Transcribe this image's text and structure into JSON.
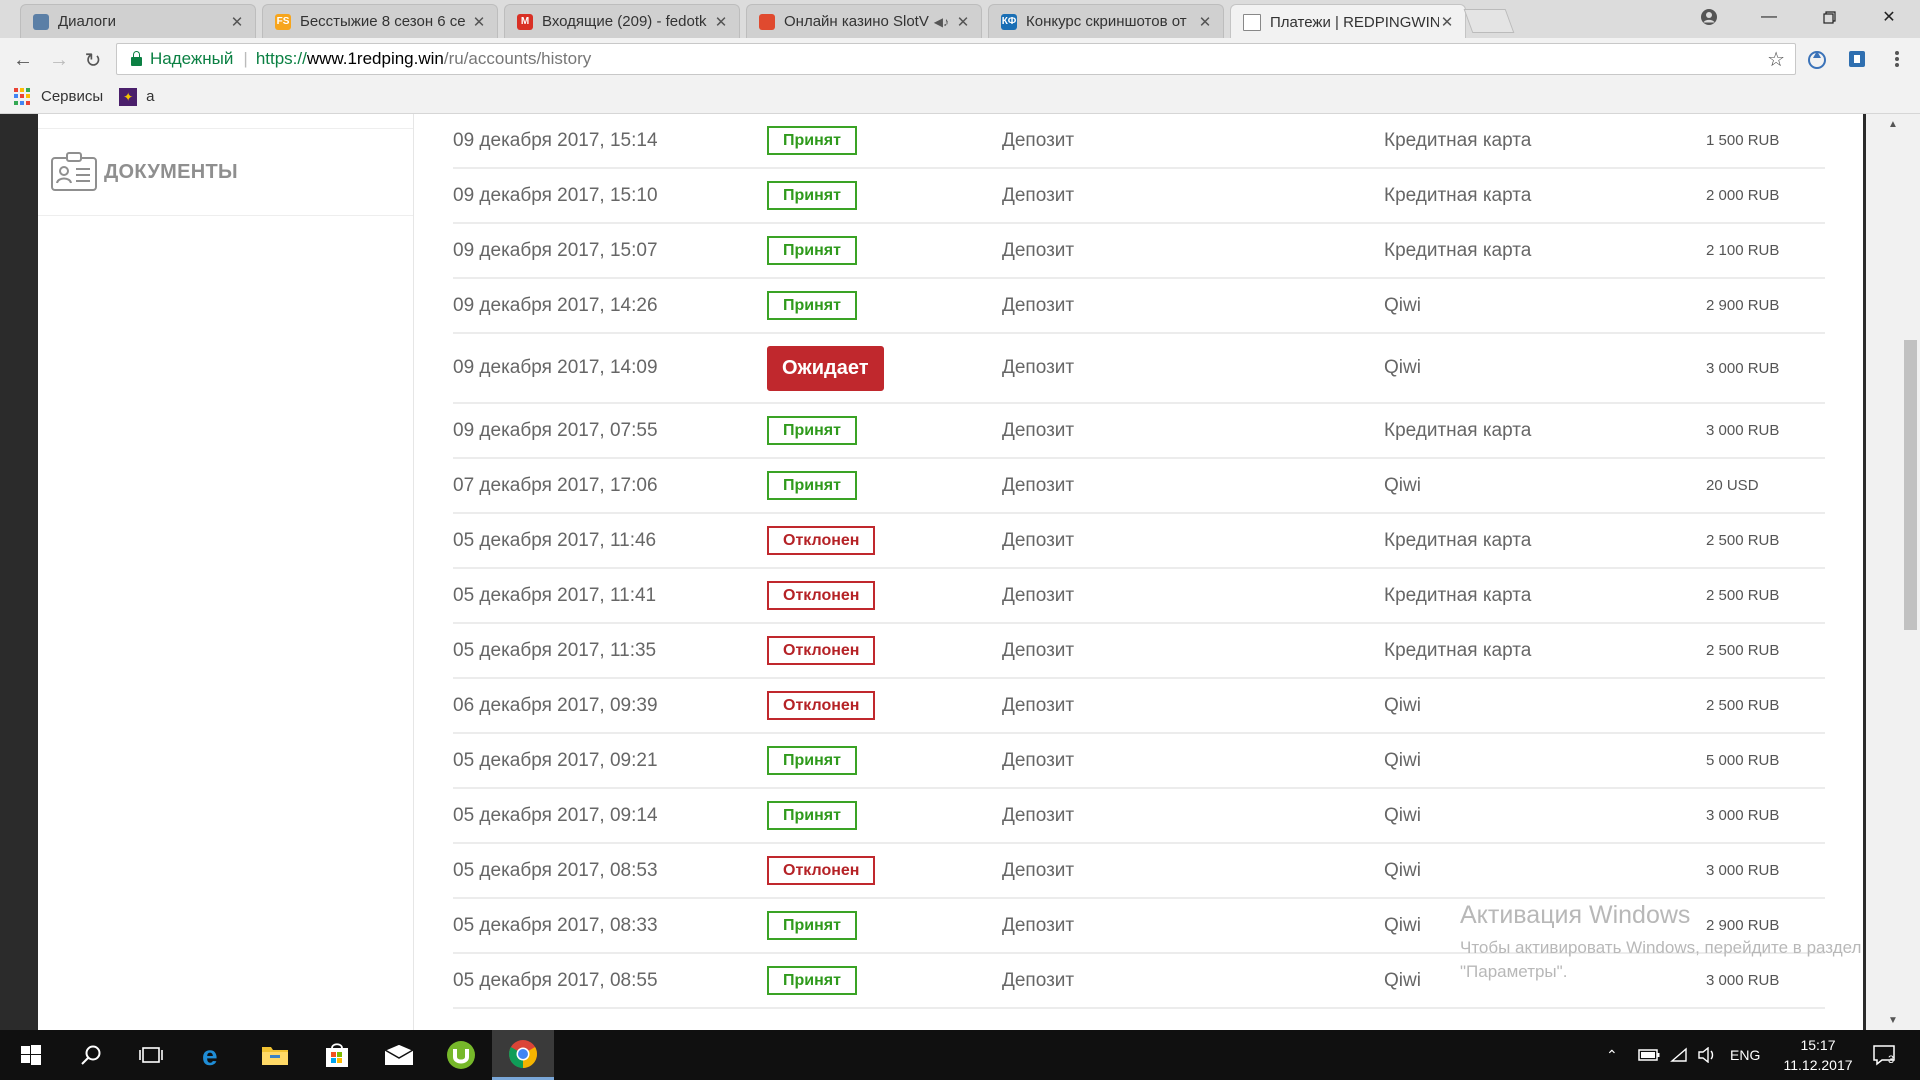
{
  "browser": {
    "tabs": [
      {
        "title": "Диалоги",
        "active": false,
        "favicon_color": "#5b7fa6"
      },
      {
        "title": "Бесстыжие 8 сезон 6 се",
        "active": false,
        "favicon_color": "#f7a51c",
        "favicon_text": "FS"
      },
      {
        "title": "Входящие (209) - fedotk",
        "active": false,
        "favicon_color": "#d93025",
        "favicon_text": "M"
      },
      {
        "title": "Онлайн казино SlotV",
        "active": false,
        "favicon_color": "#e04a2f",
        "audio": true
      },
      {
        "title": "Конкурс скриншотов от",
        "active": false,
        "favicon_color": "#1a6fb5",
        "favicon_text": "КФ"
      },
      {
        "title": "Платежи | REDPINGWIN",
        "active": true,
        "favicon_color": "#ffffff"
      }
    ],
    "secure_label": "Надежный",
    "url_scheme": "https://",
    "url_host": "www.1redping.win",
    "url_path": "/ru/accounts/history",
    "bookmarks": [
      {
        "label": "Сервисы",
        "icon": "apps-icon"
      },
      {
        "label": "a",
        "icon": "bookmark-favicon"
      }
    ]
  },
  "sidebar": {
    "items": [
      {
        "label": "ДОКУМЕНТЫ",
        "icon": "documents-icon"
      }
    ]
  },
  "status_labels": {
    "accepted": "Принят",
    "pending": "Ожидает",
    "declined": "Отклонен"
  },
  "transactions": [
    {
      "date": "09 декабря 2017, 15:14",
      "status": "accepted",
      "status_label": "Принят",
      "type": "Депозит",
      "method": "Кредитная карта",
      "amount": "1 500 RUB"
    },
    {
      "date": "09 декабря 2017, 15:10",
      "status": "accepted",
      "status_label": "Принят",
      "type": "Депозит",
      "method": "Кредитная карта",
      "amount": "2 000 RUB"
    },
    {
      "date": "09 декабря 2017, 15:07",
      "status": "accepted",
      "status_label": "Принят",
      "type": "Депозит",
      "method": "Кредитная карта",
      "amount": "2 100 RUB"
    },
    {
      "date": "09 декабря 2017, 14:26",
      "status": "accepted",
      "status_label": "Принят",
      "type": "Депозит",
      "method": "Qiwi",
      "amount": "2 900 RUB"
    },
    {
      "date": "09 декабря 2017, 14:09",
      "status": "pending",
      "status_label": "Ожидает",
      "type": "Депозит",
      "method": "Qiwi",
      "amount": "3 000 RUB"
    },
    {
      "date": "09 декабря 2017, 07:55",
      "status": "accepted",
      "status_label": "Принят",
      "type": "Депозит",
      "method": "Кредитная карта",
      "amount": "3 000 RUB"
    },
    {
      "date": "07 декабря 2017, 17:06",
      "status": "accepted",
      "status_label": "Принят",
      "type": "Депозит",
      "method": "Qiwi",
      "amount": "20 USD"
    },
    {
      "date": "05 декабря 2017, 11:46",
      "status": "declined",
      "status_label": "Отклонен",
      "type": "Депозит",
      "method": "Кредитная карта",
      "amount": "2 500 RUB"
    },
    {
      "date": "05 декабря 2017, 11:41",
      "status": "declined",
      "status_label": "Отклонен",
      "type": "Депозит",
      "method": "Кредитная карта",
      "amount": "2 500 RUB"
    },
    {
      "date": "05 декабря 2017, 11:35",
      "status": "declined",
      "status_label": "Отклонен",
      "type": "Депозит",
      "method": "Кредитная карта",
      "amount": "2 500 RUB"
    },
    {
      "date": "06 декабря 2017, 09:39",
      "status": "declined",
      "status_label": "Отклонен",
      "type": "Депозит",
      "method": "Qiwi",
      "amount": "2 500 RUB"
    },
    {
      "date": "05 декабря 2017, 09:21",
      "status": "accepted",
      "status_label": "Принят",
      "type": "Депозит",
      "method": "Qiwi",
      "amount": "5 000 RUB"
    },
    {
      "date": "05 декабря 2017, 09:14",
      "status": "accepted",
      "status_label": "Принят",
      "type": "Депозит",
      "method": "Qiwi",
      "amount": "3 000 RUB"
    },
    {
      "date": "05 декабря 2017, 08:53",
      "status": "declined",
      "status_label": "Отклонен",
      "type": "Депозит",
      "method": "Qiwi",
      "amount": "3 000 RUB"
    },
    {
      "date": "05 декабря 2017, 08:33",
      "status": "accepted",
      "status_label": "Принят",
      "type": "Депозит",
      "method": "Qiwi",
      "amount": "2 900 RUB"
    },
    {
      "date": "05 декабря 2017, 08:55",
      "status": "accepted",
      "status_label": "Принят",
      "type": "Депозит",
      "method": "Qiwi",
      "amount": "3 000 RUB"
    }
  ],
  "watermark": {
    "title": "Активация Windows",
    "line1": "Чтобы активировать Windows, перейдите в раздел",
    "line2": "\"Параметры\"."
  },
  "taskbar": {
    "apps": [
      "windows-start-icon",
      "search-icon",
      "task-view-icon",
      "edge-icon",
      "file-explorer-icon",
      "store-icon",
      "mail-icon",
      "utorrent-icon",
      "chrome-icon"
    ],
    "language": "ENG",
    "time": "15:17",
    "date": "11.12.2017",
    "notifications_count": "3"
  },
  "colors": {
    "accepted": "#2f9a1c",
    "declined": "#b52226",
    "pending_bg": "#c0282d",
    "secure_green": "#0b8043"
  }
}
